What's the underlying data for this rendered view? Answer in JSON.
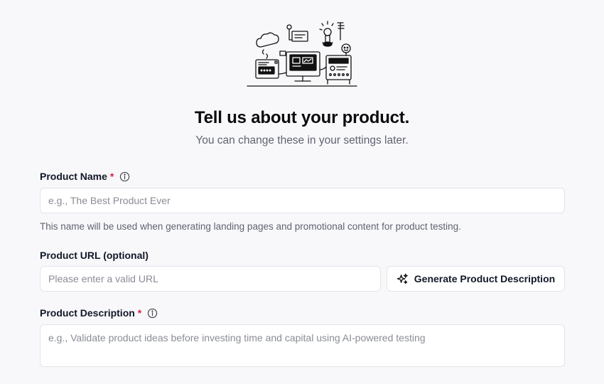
{
  "header": {
    "title": "Tell us about your product.",
    "subtitle": "You can change these in your settings later."
  },
  "form": {
    "product_name": {
      "label": "Product Name",
      "required_mark": "*",
      "placeholder": "e.g., The Best Product Ever",
      "value": "",
      "helper": "This name will be used when generating landing pages and promotional content for product testing.",
      "icon": "info-icon"
    },
    "product_url": {
      "label": "Product URL (optional)",
      "placeholder": "Please enter a valid URL",
      "value": ""
    },
    "generate_button": {
      "label": "Generate Product Description",
      "icon": "sparkles-icon"
    },
    "product_description": {
      "label": "Product Description",
      "required_mark": "*",
      "placeholder": "e.g., Validate product ideas before investing time and capital using AI-powered testing",
      "value": "",
      "icon": "info-icon"
    }
  },
  "colors": {
    "background": "#f8f8fb",
    "required": "#e11d48",
    "border": "#e3e4e8",
    "muted_text": "#5f6370"
  }
}
